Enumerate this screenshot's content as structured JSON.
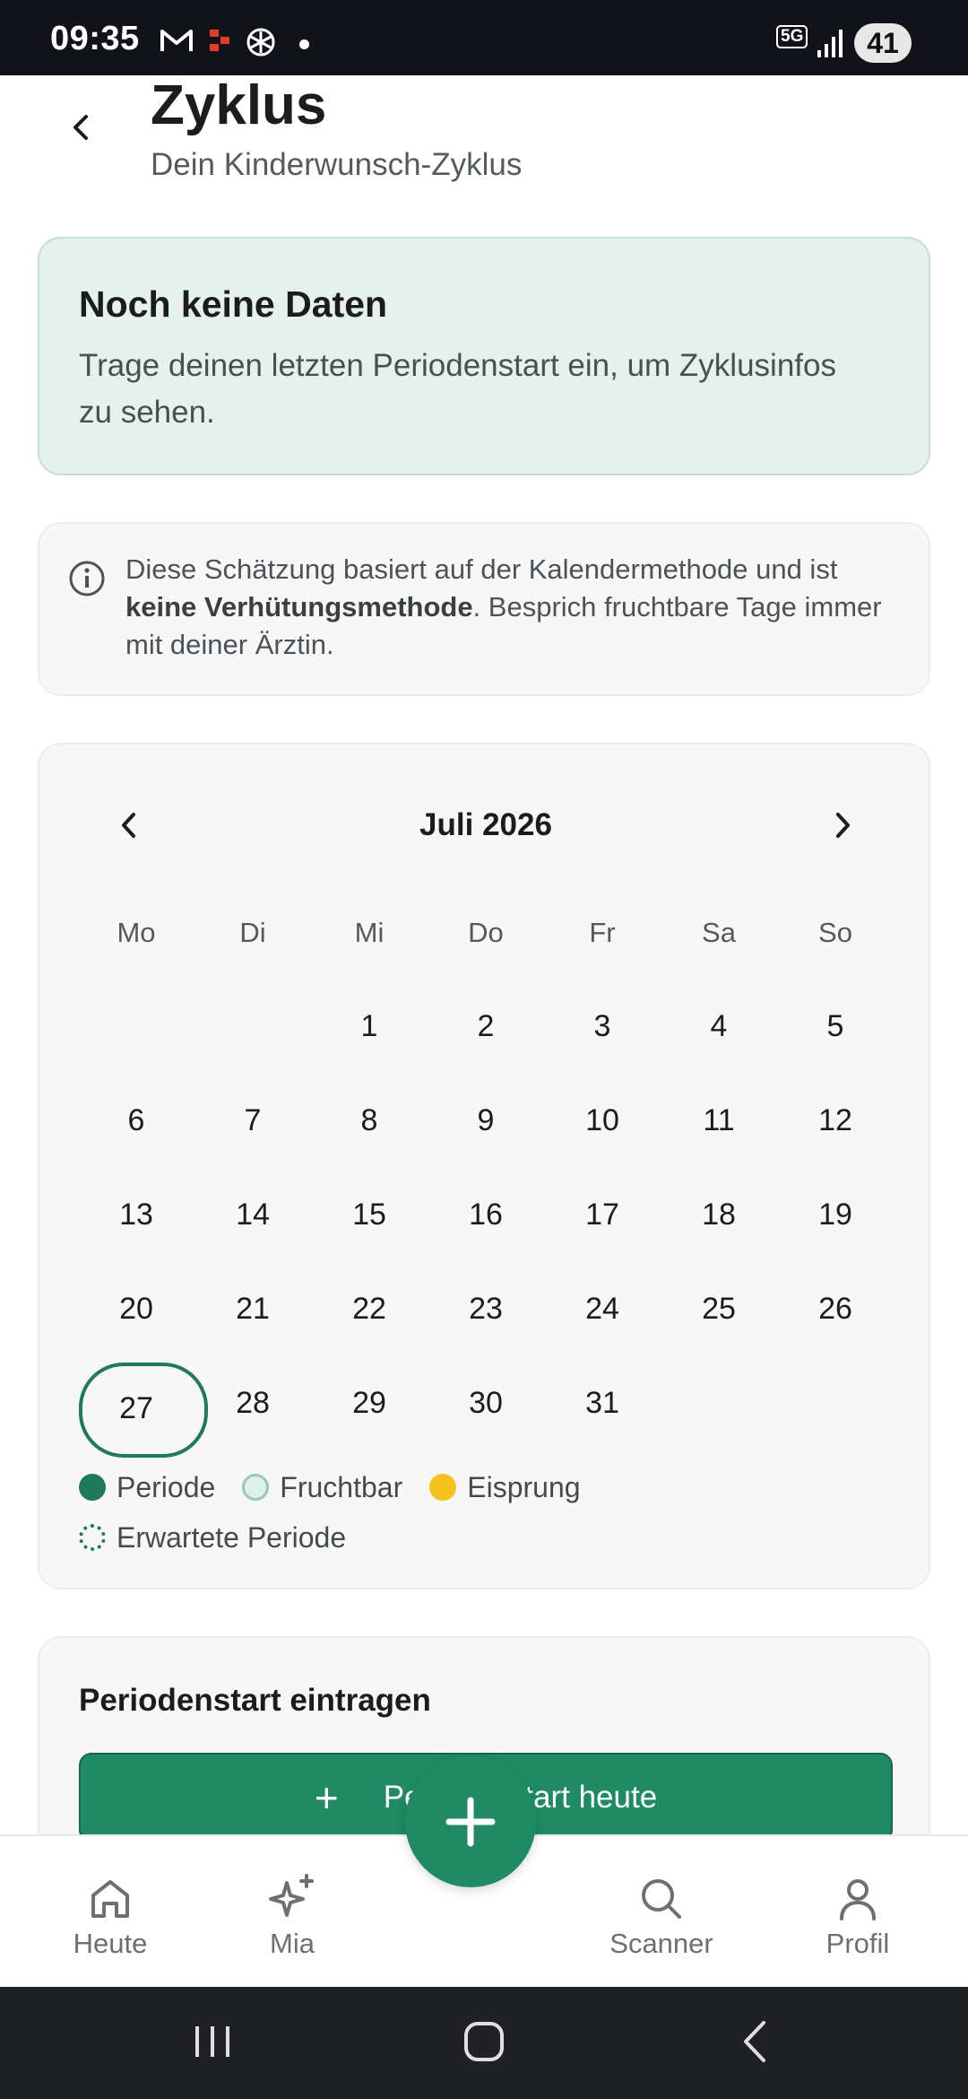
{
  "status_bar": {
    "time": "09:35",
    "network": "5G",
    "battery": "41"
  },
  "header": {
    "title": "Zyklus",
    "subtitle": "Dein Kinderwunsch-Zyklus"
  },
  "empty_card": {
    "title": "Noch keine Daten",
    "text": "Trage deinen letzten Periodenstart ein, um Zyklusinfos zu sehen."
  },
  "info_card": {
    "text_before": "Diese Schätzung basiert auf der Kalendermethode und ist ",
    "text_bold": "keine Verhütungsmethode",
    "text_after": ". Besprich fruchtbare Tage immer mit deiner Ärztin."
  },
  "calendar": {
    "month_label": "Juli 2026",
    "weekdays": [
      "Mo",
      "Di",
      "Mi",
      "Do",
      "Fr",
      "Sa",
      "So"
    ],
    "leading_blanks": 2,
    "days": [
      "1",
      "2",
      "3",
      "4",
      "5",
      "6",
      "7",
      "8",
      "9",
      "10",
      "11",
      "12",
      "13",
      "14",
      "15",
      "16",
      "17",
      "18",
      "19",
      "20",
      "21",
      "22",
      "23",
      "24",
      "25",
      "26",
      "27",
      "28",
      "29",
      "30",
      "31"
    ],
    "today": "27",
    "legend": {
      "periode": "Periode",
      "fruchtbar": "Fruchtbar",
      "eisprung": "Eisprung",
      "erwartet": "Erwartete Periode"
    }
  },
  "entry_card": {
    "title": "Periodenstart eintragen",
    "button_label": "Periodenstart heute"
  },
  "bottom_nav": {
    "heute": "Heute",
    "mia": "Mia",
    "scanner": "Scanner",
    "profil": "Profil"
  },
  "colors": {
    "primary": "#1f8a63",
    "primary_dark": "#1f7a57",
    "empty_card_bg": "#e5f1ec",
    "eisprung": "#f4c21a"
  }
}
